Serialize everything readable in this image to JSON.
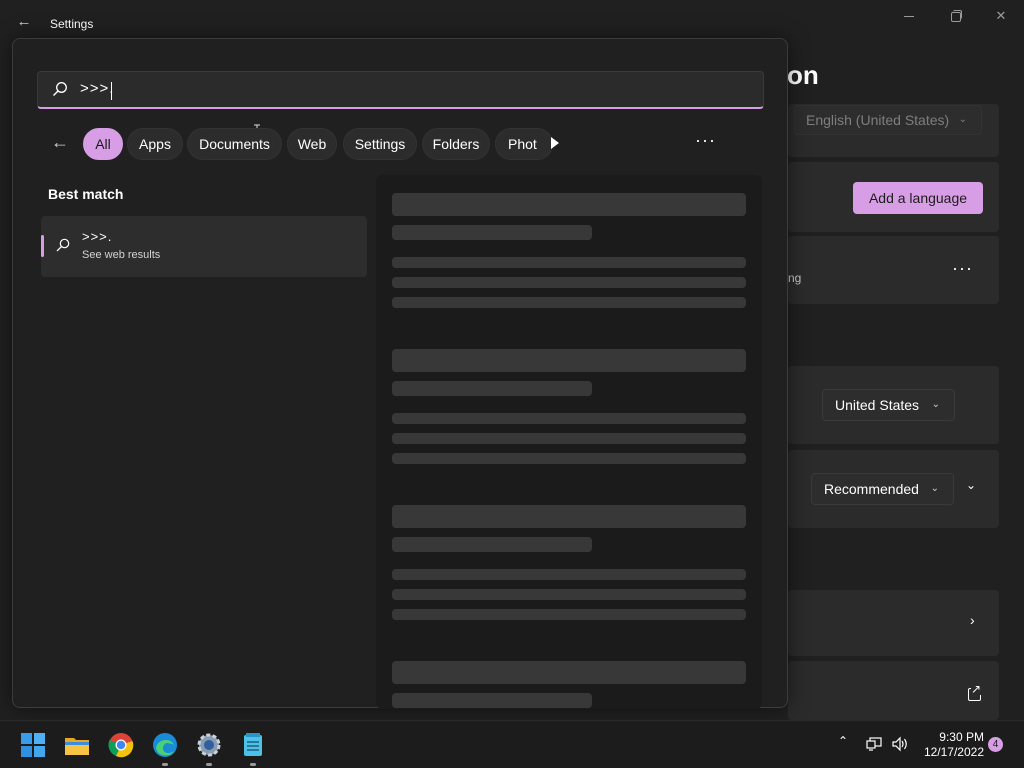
{
  "settings_window": {
    "title": "Settings",
    "heading_fragment": "on",
    "display_language_value": "English (United States)",
    "add_language_label": "Add a language",
    "row_text_fragment": "ng",
    "region_value": "United States",
    "regional_format_value": "Recommended"
  },
  "search": {
    "query": ">>>.",
    "filters": [
      {
        "label": "All",
        "active": true
      },
      {
        "label": "Apps"
      },
      {
        "label": "Documents"
      },
      {
        "label": "Web"
      },
      {
        "label": "Settings"
      },
      {
        "label": "Folders"
      },
      {
        "label": "Phot"
      }
    ],
    "best_match_label": "Best match",
    "result": {
      "title": ">>>.",
      "subtitle": "See web results"
    }
  },
  "taskbar": {
    "apps": [
      "windows-start",
      "file-explorer",
      "chrome",
      "edge",
      "settings",
      "notepad"
    ],
    "time": "9:30 PM",
    "date": "12/17/2022",
    "notification_count": "4"
  },
  "colors": {
    "accent": "#d89ee5",
    "background": "#202020",
    "card": "#2b2b2b"
  }
}
